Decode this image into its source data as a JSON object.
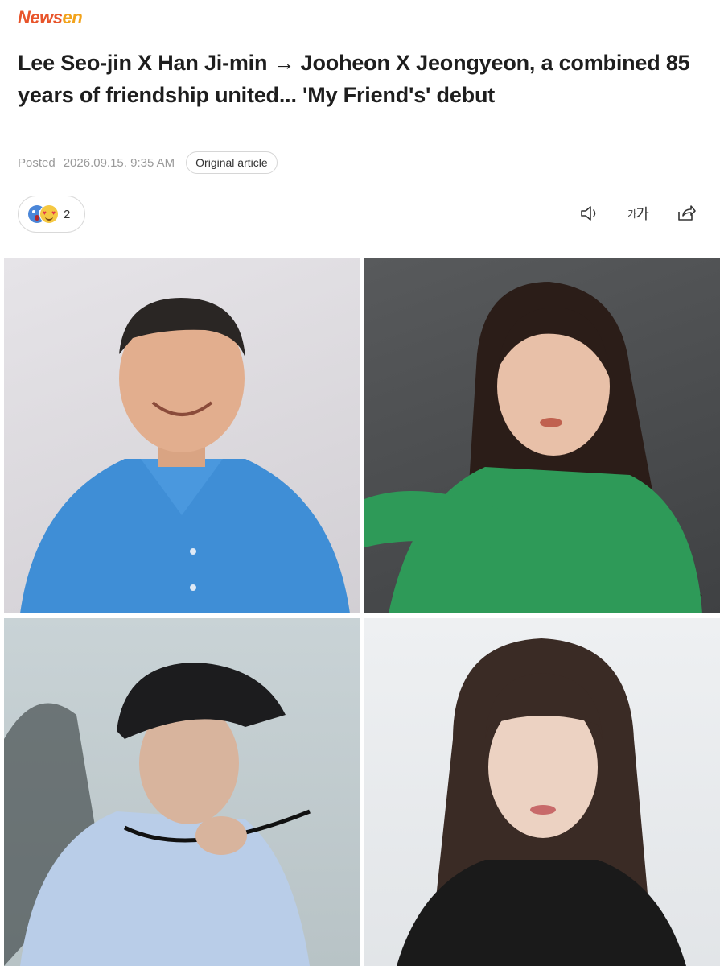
{
  "brand": {
    "logo_part1": "News",
    "logo_part2": "en"
  },
  "article": {
    "headline": "Lee Seo-jin X Han Ji-min → Jooheon X Jeongyeon, a combined 85 years of friendship united... 'My Friend's' debut",
    "posted_label": "Posted",
    "posted_date": "2026.09.15. 9:35 AM",
    "original_article_label": "Original article"
  },
  "reactions": {
    "count": "2",
    "icons": [
      "wow-emoji",
      "heart-eyes-emoji"
    ]
  },
  "toolbar": {
    "tts_icon": "speaker-icon",
    "font_size_label_small": "가",
    "font_size_label_big": "가",
    "share_icon": "share-icon"
  },
  "photos": [
    {
      "name": "photo-man-blue-shirt"
    },
    {
      "name": "photo-woman-green-sweater"
    },
    {
      "name": "photo-man-black-cap"
    },
    {
      "name": "photo-woman-black-top"
    }
  ],
  "colors": {
    "logo_primary": "#e8542a",
    "logo_secondary": "#f2a31b",
    "meta_gray": "#9a9a9a"
  }
}
